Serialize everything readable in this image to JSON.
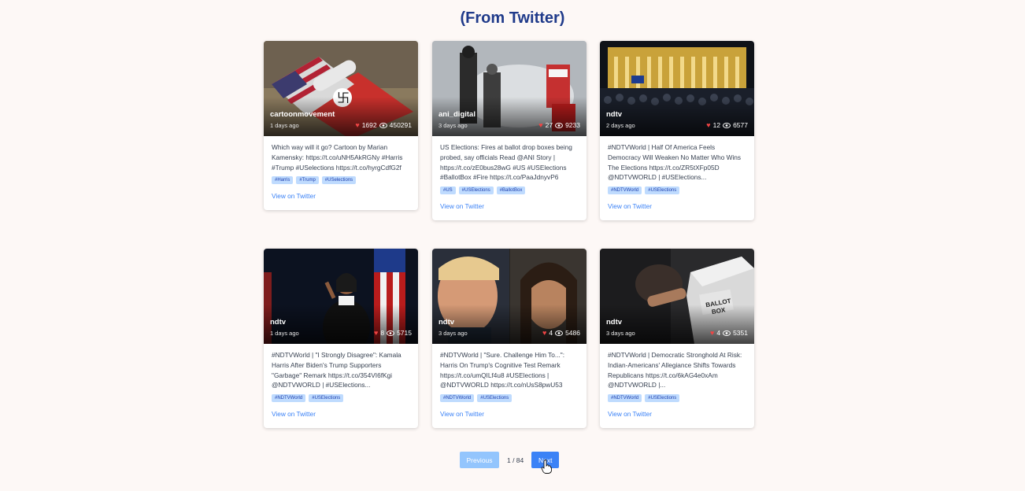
{
  "header": {
    "title": "(From Twitter)"
  },
  "cards": [
    {
      "author": "cartoonmovement",
      "time_ago": "1 days ago",
      "likes": "1692",
      "views": "450291",
      "text": "Which way will it go? Cartoon by Marian Kamensky: https://t.co/uNH5AkRGNy #Harris #Trump #USelections https://t.co/hyrgCdfG2f",
      "tags": [
        "#Harris",
        "#Trump",
        "#USelections"
      ],
      "link_label": "View on Twitter",
      "image_icon": "flag-cartoon-image"
    },
    {
      "author": "ani_digital",
      "time_ago": "3 days ago",
      "likes": "27",
      "views": "9233",
      "text": "US Elections: Fires at ballot drop boxes being probed, say officials Read @ANI Story | https://t.co/zE0bus28wG #US #USElections #BallotBox #Fire https://t.co/PaaJdnyvP6",
      "tags": [
        "#US",
        "#USElections",
        "#BallotBox"
      ],
      "link_label": "View on Twitter",
      "image_icon": "drop-box-fire-image"
    },
    {
      "author": "ndtv",
      "time_ago": "2 days ago",
      "likes": "12",
      "views": "6577",
      "text": "#NDTVWorld | Half Of America Feels Democracy Will Weaken No Matter Who Wins The Elections https://t.co/ZR5tXFp05D @NDTVWORLD | #USElections...",
      "tags": [
        "#NDTVWorld",
        "#USElections"
      ],
      "link_label": "View on Twitter",
      "image_icon": "crowd-building-night-image"
    },
    {
      "author": "ndtv",
      "time_ago": "1 days ago",
      "likes": "8",
      "views": "5715",
      "text": "#NDTVWorld | \"I Strongly Disagree\": Kamala Harris After Biden's Trump Supporters \"Garbage\" Remark https://t.co/354VI6fKgi @NDTVWORLD | #USElections...",
      "tags": [
        "#NDTVWorld",
        "#USElections"
      ],
      "link_label": "View on Twitter",
      "image_icon": "speaker-podium-image"
    },
    {
      "author": "ndtv",
      "time_ago": "3 days ago",
      "likes": "4",
      "views": "5486",
      "text": "#NDTVWorld | \"Sure. Challenge Him To...\": Harris On Trump's Cognitive Test Remark https://t.co/umQILf4u8 #USElections | @NDTVWORLD https://t.co/nUsS8pwU53",
      "tags": [
        "#NDTVWorld",
        "#USElections"
      ],
      "link_label": "View on Twitter",
      "image_icon": "two-portraits-image"
    },
    {
      "author": "ndtv",
      "time_ago": "3 days ago",
      "likes": "4",
      "views": "5351",
      "text": "#NDTVWorld | Democratic Stronghold At Risk: Indian-Americans' Allegiance Shifts Towards Republicans https://t.co/6kAG4e0xAm @NDTVWORLD |...",
      "tags": [
        "#NDTVWorld",
        "#USElections"
      ],
      "link_label": "View on Twitter",
      "image_icon": "ballot-box-image"
    }
  ],
  "pagination": {
    "prev_label": "Previous",
    "page_info": "1 / 84",
    "next_label": "Next"
  },
  "colors": {
    "title": "#1f3a8a",
    "accent": "#3b82f6",
    "accent_light": "#93c5fd",
    "like": "#ef4444"
  }
}
